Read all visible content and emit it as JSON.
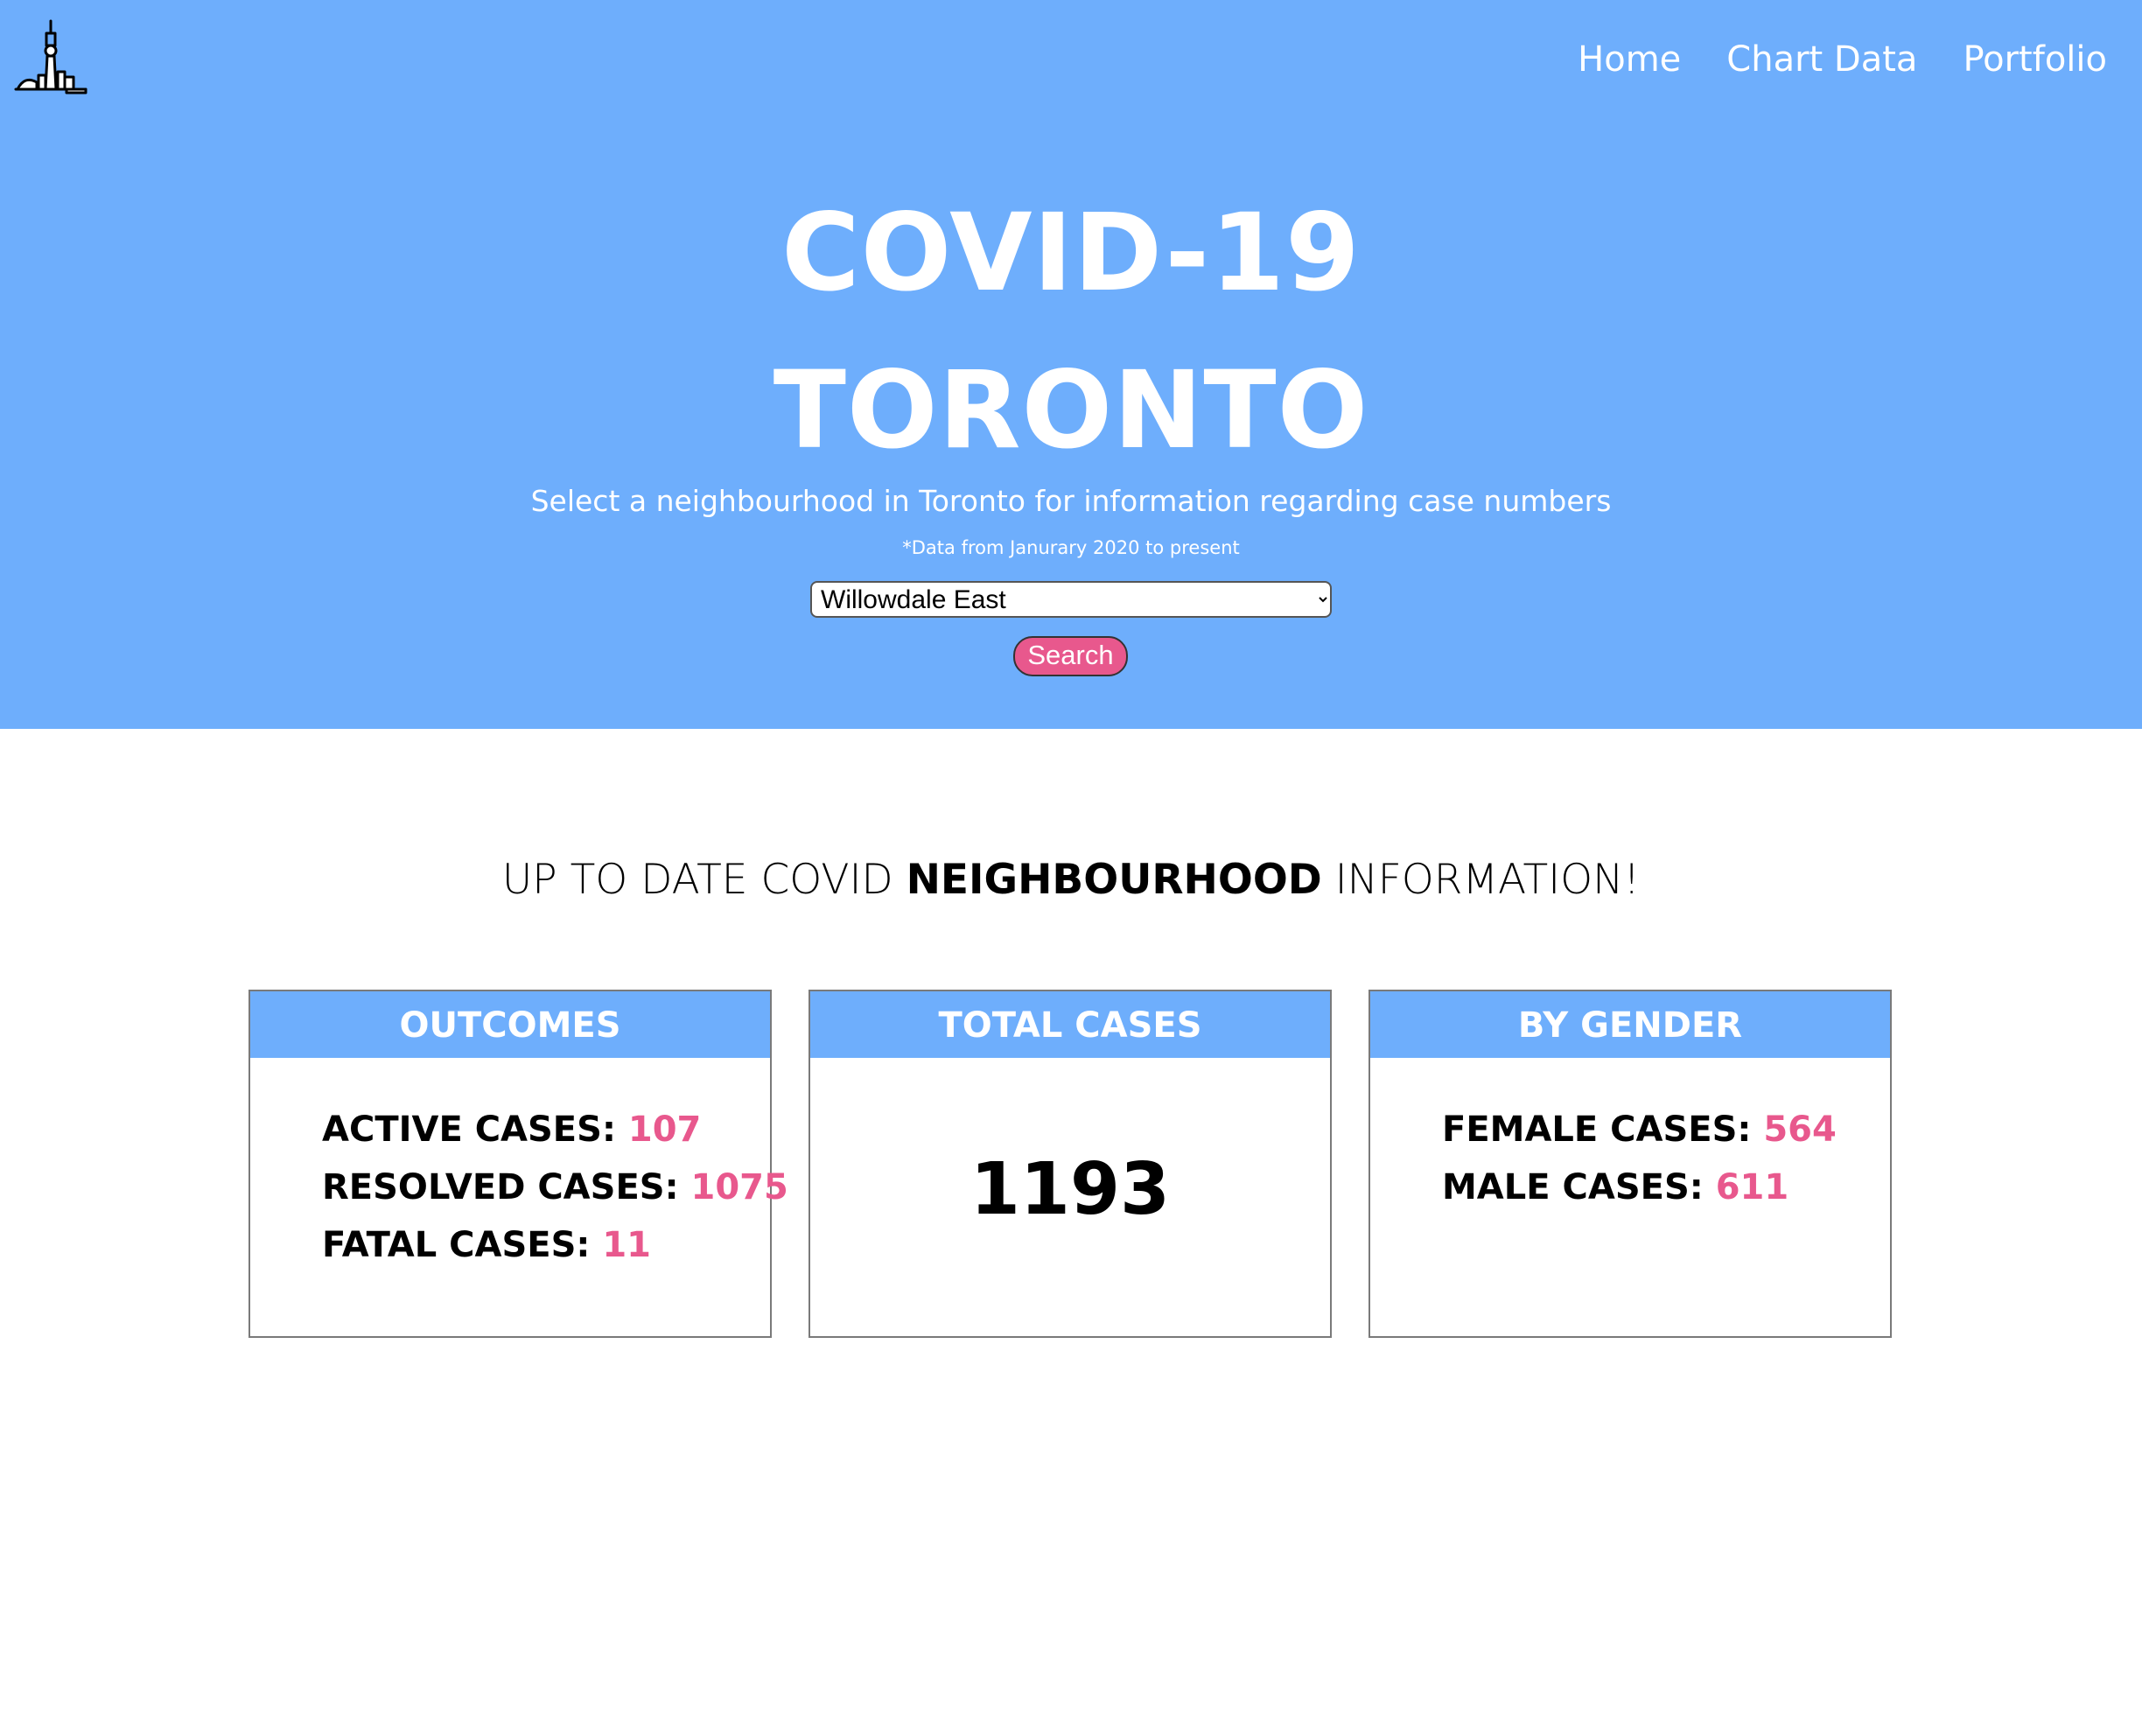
{
  "nav": {
    "home": "Home",
    "chart_data": "Chart Data",
    "portfolio": "Portfolio"
  },
  "hero": {
    "title_line1": "COVID-19",
    "title_line2": "TORONTO",
    "subtitle": "Select a neighbourhood in Toronto for information regarding case numbers",
    "note": "*Data from Janurary 2020 to present",
    "selected_neighbourhood": "Willowdale East",
    "search_label": "Search"
  },
  "section": {
    "title_part1": "UP TO DATE COVID ",
    "title_part2": "NEIGHBOURHOOD",
    "title_part3": " INFORMATION!"
  },
  "cards": {
    "outcomes": {
      "title": "OUTCOMES",
      "active_label": "ACTIVE CASES: ",
      "active_value": "107",
      "resolved_label": "RESOLVED CASES: ",
      "resolved_value": "1075",
      "fatal_label": "FATAL CASES: ",
      "fatal_value": "11"
    },
    "total": {
      "title": "TOTAL CASES",
      "value": "1193"
    },
    "gender": {
      "title": "BY GENDER",
      "female_label": "FEMALE CASES: ",
      "female_value": "564",
      "male_label": "MALE CASES: ",
      "male_value": "611"
    }
  },
  "colors": {
    "hero_bg": "#6eaefc",
    "accent_pink": "#e8588d"
  },
  "icons": {
    "logo": "cn-tower-skyline-icon",
    "dropdown": "chevron-down-icon"
  }
}
